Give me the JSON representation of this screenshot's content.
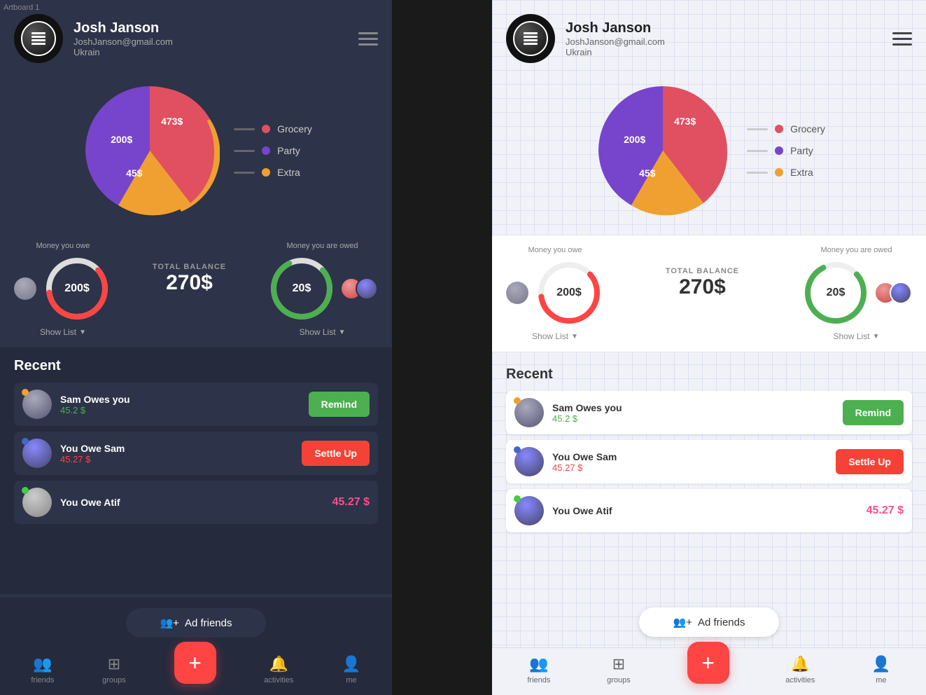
{
  "artboard_label": "Artboard 1",
  "user": {
    "name": "Josh Janson",
    "email": "JoshJanson@gmail.com",
    "country": "Ukrain"
  },
  "chart": {
    "segments": [
      {
        "label": "Grocery",
        "value": "200$",
        "color": "#e05060"
      },
      {
        "label": "Party",
        "value": "473$",
        "color": "#f0a030"
      },
      {
        "label": "Extra",
        "value": "45$",
        "color": "#7744cc"
      }
    ],
    "legend": [
      {
        "name": "Grocery",
        "dot_color": "#e05060"
      },
      {
        "name": "Party",
        "dot_color": "#7744cc"
      },
      {
        "name": "Extra",
        "dot_color": "#f0a030"
      }
    ]
  },
  "balance": {
    "owe_label": "Money you owe",
    "owed_label": "Money you are owed",
    "total_label": "TOTAL BALANCE",
    "total_value": "270$",
    "owe_value": "200$",
    "owed_value": "20$",
    "show_list": "Show List"
  },
  "recent": {
    "title": "Recent",
    "items": [
      {
        "name": "Sam Owes you",
        "amount": "45.2 $",
        "amount_type": "green",
        "action": "Remind",
        "action_type": "green",
        "status_color": "#f0a030"
      },
      {
        "name": "You Owe Sam",
        "amount": "45.27 $",
        "amount_type": "red",
        "action": "Settle Up",
        "action_type": "red",
        "status_color": "#4466cc"
      },
      {
        "name": "You Owe Atif",
        "amount": "45.27 $",
        "amount_type": "pink",
        "status_color": "#44cc44"
      }
    ]
  },
  "add_friends": {
    "label": "Ad friends"
  },
  "nav": {
    "items": [
      {
        "label": "friends",
        "icon": "👥"
      },
      {
        "label": "groups",
        "icon": "⊞"
      },
      {
        "label": "",
        "icon": "+",
        "is_add": true
      },
      {
        "label": "activities",
        "icon": "🔔"
      },
      {
        "label": "me",
        "icon": "👤"
      }
    ]
  }
}
